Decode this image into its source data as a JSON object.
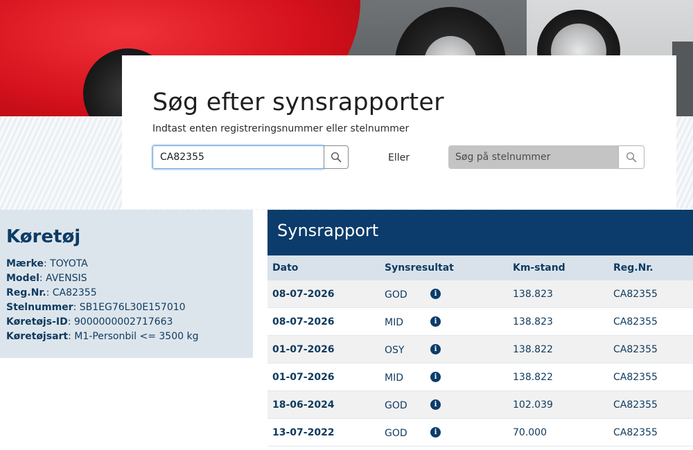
{
  "search": {
    "title": "Søg efter synsrapporter",
    "subtitle": "Indtast enten registreringsnummer eller stelnummer",
    "reg_value": "CA82355",
    "or_label": "Eller",
    "vin_placeholder": "Søg på stelnummer"
  },
  "vehicle": {
    "title": "Køretøj",
    "fields": [
      {
        "key": "Mærke",
        "value": "TOYOTA"
      },
      {
        "key": "Model",
        "value": "AVENSIS"
      },
      {
        "key": "Reg.Nr.",
        "value": "CA82355"
      },
      {
        "key": "Stelnummer",
        "value": "SB1EG76L30E157010"
      },
      {
        "key": "Køretøjs-ID",
        "value": "9000000002717663"
      },
      {
        "key": "Køretøjsart",
        "value": "M1-Personbil <= 3500 kg"
      }
    ]
  },
  "report": {
    "title": "Synsrapport",
    "columns": {
      "date": "Dato",
      "result": "Synsresultat",
      "km": "Km-stand",
      "reg": "Reg.Nr."
    },
    "info_glyph": "i",
    "rows": [
      {
        "date": "08-07-2026",
        "result": "GOD",
        "km": "138.823",
        "reg": "CA82355"
      },
      {
        "date": "08-07-2026",
        "result": "MID",
        "km": "138.823",
        "reg": "CA82355"
      },
      {
        "date": "01-07-2026",
        "result": "OSY",
        "km": "138.822",
        "reg": "CA82355"
      },
      {
        "date": "01-07-2026",
        "result": "MID",
        "km": "138.822",
        "reg": "CA82355"
      },
      {
        "date": "18-06-2024",
        "result": "GOD",
        "km": "102.039",
        "reg": "CA82355"
      },
      {
        "date": "13-07-2022",
        "result": "GOD",
        "km": "70.000",
        "reg": "CA82355"
      }
    ]
  },
  "colors": {
    "brand": "#0b3c6b",
    "panel": "#dde5ec",
    "row_alt": "#f1f1f1"
  },
  "icons": {
    "search_buttons": "search-icon",
    "result_info": "info-icon"
  }
}
